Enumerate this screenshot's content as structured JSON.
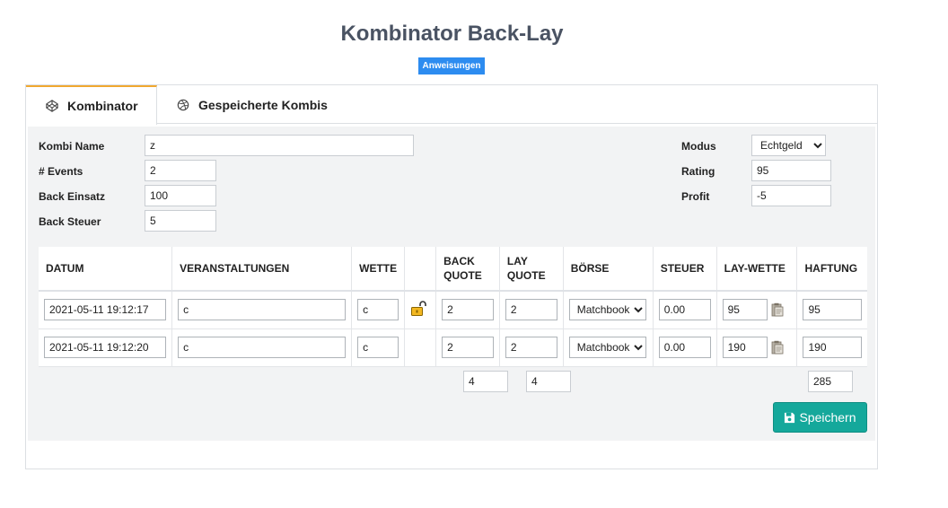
{
  "page": {
    "title": "Kombinator Back-Lay",
    "instructions_label": "Anweisungen"
  },
  "tabs": [
    {
      "label": "Kombinator",
      "active": true,
      "icon": "codepen-icon"
    },
    {
      "label": "Gespeicherte Kombis",
      "active": false,
      "icon": "dribbble-icon"
    }
  ],
  "form": {
    "kombi_name_label": "Kombi Name",
    "kombi_name_value": "z",
    "events_label": "# Events",
    "events_value": "2",
    "back_einsatz_label": "Back Einsatz",
    "back_einsatz_value": "100",
    "back_steuer_label": "Back Steuer",
    "back_steuer_value": "5",
    "modus_label": "Modus",
    "modus_value": "Echtgeld",
    "rating_label": "Rating",
    "rating_value": "95",
    "profit_label": "Profit",
    "profit_value": "-5"
  },
  "table": {
    "headers": {
      "datum": "DATUM",
      "veranstaltungen": "VERANSTALTUNGEN",
      "wette": "WETTE",
      "back_quote_1": "BACK",
      "back_quote_2": "QUOTE",
      "lay_quote_1": "LAY",
      "lay_quote_2": "QUOTE",
      "boerse": "BÖRSE",
      "steuer": "STEUER",
      "lay_wette": "LAY-WETTE",
      "haftung": "HAFTUNG"
    },
    "rows": [
      {
        "datum": "2021-05-11 19:12:17",
        "veranstaltung": "c",
        "wette": "c",
        "back_quote": "2",
        "lay_quote": "2",
        "boerse": "Matchbook",
        "steuer": "0.00",
        "lay_wette": "95",
        "haftung": "95"
      },
      {
        "datum": "2021-05-11 19:12:20",
        "veranstaltung": "c",
        "wette": "c",
        "back_quote": "2",
        "lay_quote": "2",
        "boerse": "Matchbook",
        "steuer": "0.00",
        "lay_wette": "190",
        "haftung": "190"
      }
    ],
    "totals": {
      "back_quote": "4",
      "lay_quote": "4",
      "haftung": "285"
    }
  },
  "save_label": "Speichern",
  "colors": {
    "accent_tab": "#f0a830",
    "save_button": "#15a89b",
    "instructions": "#2d8cf0"
  }
}
